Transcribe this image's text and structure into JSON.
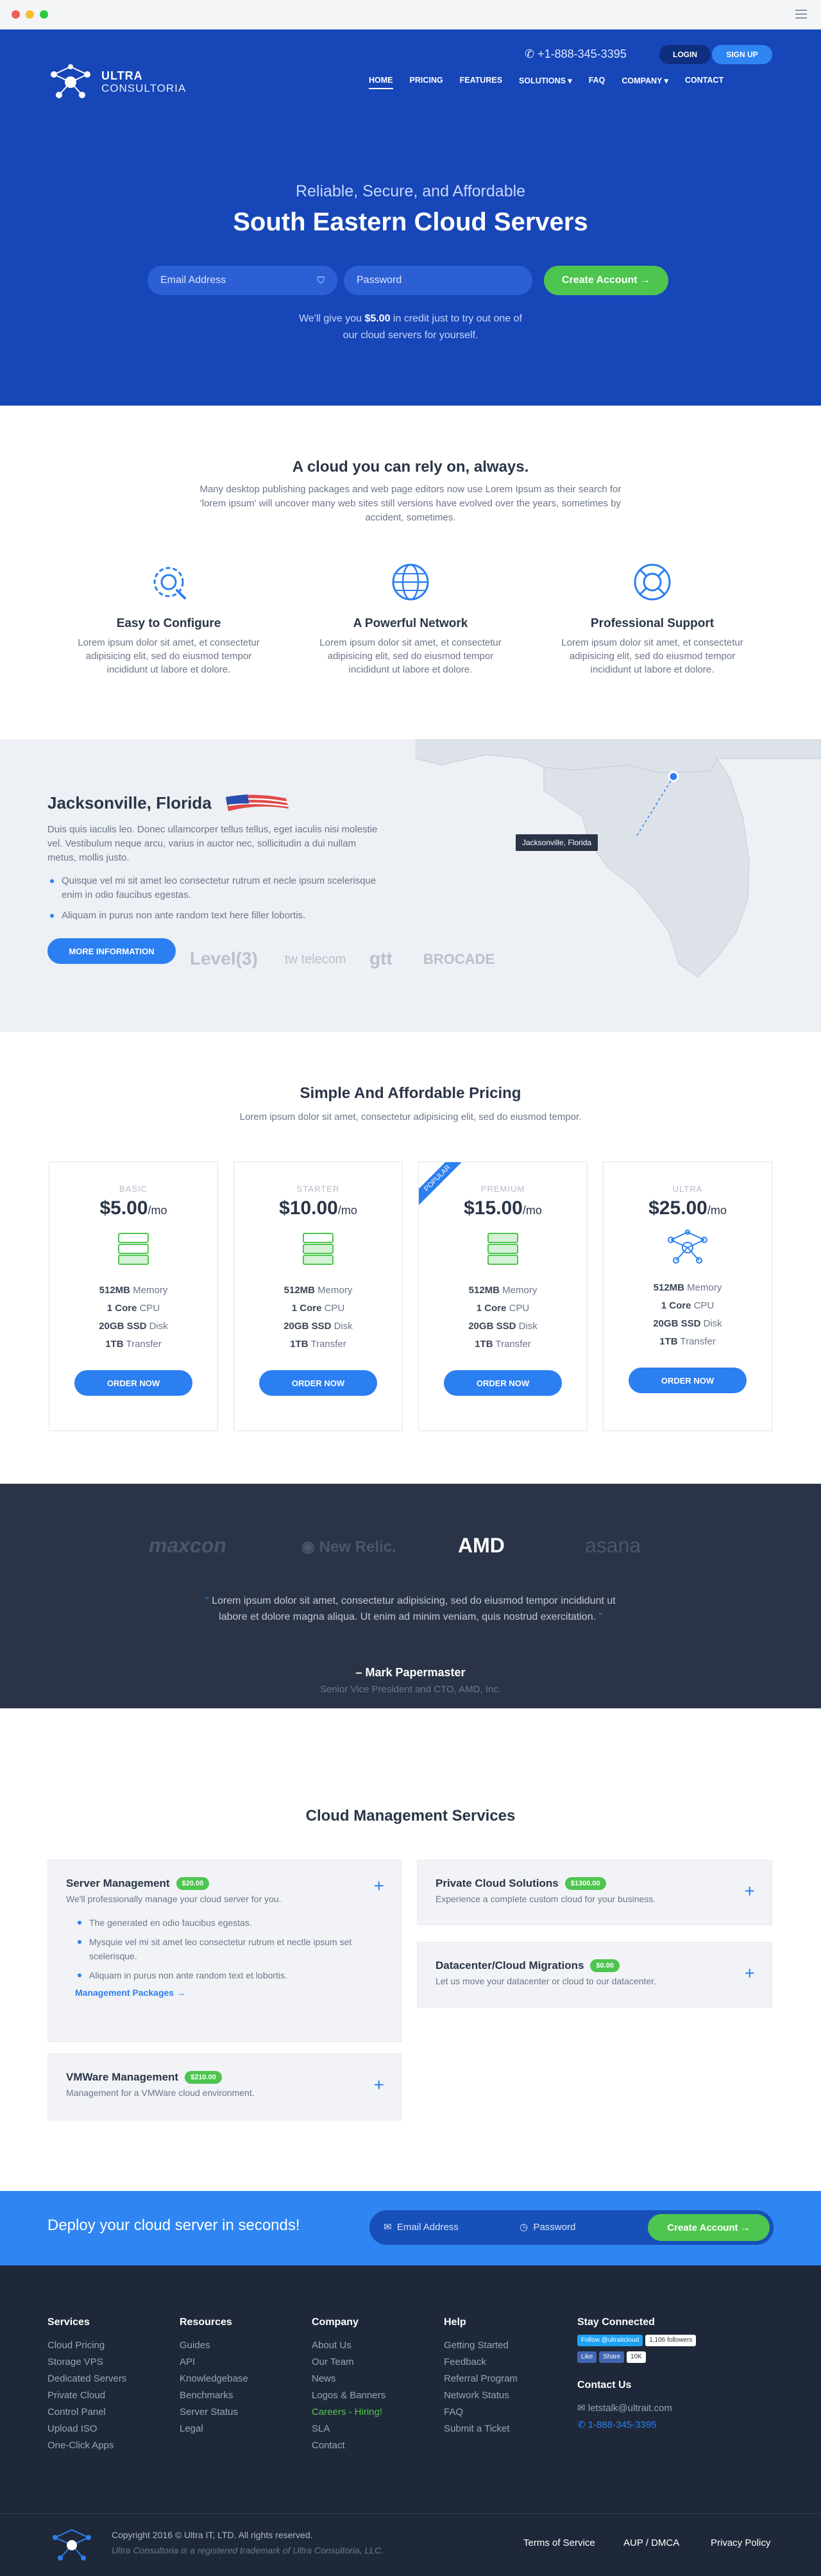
{
  "header": {
    "brand_line1": "ULTRA",
    "brand_line2": "CONSULTORIA",
    "phone": "+1-888-345-3395",
    "login": "LOGIN",
    "signup": "SIGN UP",
    "nav": [
      {
        "label": "HOME"
      },
      {
        "label": "PRICING"
      },
      {
        "label": "FEATURES"
      },
      {
        "label": "SOLUTIONS ▾"
      },
      {
        "label": "FAQ"
      },
      {
        "label": "COMPANY ▾"
      },
      {
        "label": "CONTACT"
      }
    ]
  },
  "hero": {
    "subtitle": "Reliable, Secure, and Affordable",
    "title": "South Eastern Cloud Servers",
    "email_placeholder": "Email Address",
    "password_placeholder": "Password",
    "cta": "Create Account  →",
    "note_before": "We'll give you ",
    "note_amount": "$5.00",
    "note_after": " in credit just to try out one of",
    "note_line2": "our cloud servers for yourself."
  },
  "features": {
    "title": "A cloud you can rely on, always.",
    "intro": "Many desktop publishing packages and web page editors now use Lorem Ipsum as their search for 'lorem ipsum' will uncover many web sites still versions have evolved over the years, sometimes by accident, sometimes.",
    "items": [
      {
        "icon": "gear-icon",
        "title": "Easy to Configure",
        "desc": "Lorem ipsum dolor sit amet, et consectetur adipisicing elit, sed do eiusmod tempor incididunt ut labore et dolore."
      },
      {
        "icon": "globe-icon",
        "title": "A Powerful Network",
        "desc": "Lorem ipsum dolor sit amet, et consectetur adipisicing elit, sed do eiusmod tempor incididunt ut labore et dolore."
      },
      {
        "icon": "lifebuoy-icon",
        "title": "Professional Support",
        "desc": "Lorem ipsum dolor sit amet, et consectetur adipisicing elit, sed do eiusmod tempor incididunt ut labore et dolore."
      }
    ]
  },
  "location": {
    "title": "Jacksonville, Florida",
    "desc": "Duis quis iaculis leo. Donec ullamcorper tellus tellus, eget iaculis nisi molestie vel. Vestibulum neque arcu, varius in auctor nec, sollicitudin a dui nullam metus, mollis justo.",
    "bullets": [
      "Quisque vel mi sit amet leo consectetur rutrum et necle ipsum scelerisque enim in odio faucibus egestas.",
      "Aliquam in purus non ante random text here filler lobortis."
    ],
    "button": "MORE INFORMATION",
    "map_label": "Jacksonville, Florida",
    "partners": [
      "Level(3)",
      "tw telecom",
      "gtt",
      "BROCADE"
    ]
  },
  "pricing": {
    "title": "Simple And Affordable Pricing",
    "subtitle": "Lorem ipsum dolor sit amet, consectetur adipisicing elit, sed do eiusmod tempor.",
    "popular": "Popular",
    "plans": [
      {
        "name": "BASIC",
        "price": "5.00",
        "memory": "512MB",
        "cpu": "1 Core",
        "disk": "20GB SSD",
        "transfer": "1TB",
        "button": "ORDER NOW"
      },
      {
        "name": "STARTER",
        "price": "10.00",
        "memory": "512MB",
        "cpu": "1 Core",
        "disk": "20GB SSD",
        "transfer": "1TB",
        "button": "ORDER NOW"
      },
      {
        "name": "PREMIUM",
        "price": "15.00",
        "memory": "512MB",
        "cpu": "1 Core",
        "disk": "20GB SSD",
        "transfer": "1TB",
        "button": "ORDER NOW"
      },
      {
        "name": "ULTRA",
        "price": "25.00",
        "memory": "512MB",
        "cpu": "1 Core",
        "disk": "20GB SSD",
        "transfer": "1TB",
        "button": "ORDER NOW"
      }
    ],
    "currency": "$",
    "period": "/mo",
    "label_memory": "Memory",
    "label_cpu": "CPU",
    "label_disk": "Disk",
    "label_transfer": "Transfer"
  },
  "testimonial": {
    "logos": [
      "maxcon",
      "New Relic.",
      "AMD",
      "asana"
    ],
    "quote": "Lorem ipsum dolor sit amet, consectetur adipisicing, sed do eiusmod tempor incididunt ut labore et dolore magna aliqua. Ut enim ad minim veniam, quis nostrud exercitation.",
    "author": "– Mark Papermaster",
    "role": "Senior Vice President and CTO, AMD, Inc."
  },
  "services": {
    "title": "Cloud Management Services",
    "items": [
      {
        "name": "Server Management",
        "price": "$20.00",
        "desc": "We'll professionally manage your cloud server for you.",
        "bullets": [
          "The generated en odio faucibus egestas.",
          "Mysquie vel mi sit amet leo consectetur rutrum et nectle ipsum set scelerisque.",
          "Aliquam in purus non ante random text et lobortis."
        ],
        "link": "Management Packages  →"
      },
      {
        "name": "Private Cloud Solutions",
        "price": "$1300.00",
        "desc": "Experience a complete custom cloud for your business."
      },
      {
        "name": "Datacenter/Cloud Migrations",
        "price": "$0.00",
        "desc": "Let us move your datacenter or cloud to our datacenter."
      },
      {
        "name": "VMWare Management",
        "price": "$210.00",
        "desc": "Management for a VMWare cloud environment."
      }
    ]
  },
  "deploy": {
    "title": "Deploy your cloud server in seconds!",
    "email_placeholder": "Email Address",
    "password_placeholder": "Password",
    "cta": "Create Account  →"
  },
  "footer": {
    "columns": [
      {
        "title": "Services",
        "links": [
          "Cloud Pricing",
          "Storage VPS",
          "Dedicated Servers",
          "Private Cloud",
          "Control Panel",
          "Upload ISO",
          "One-Click Apps"
        ]
      },
      {
        "title": "Resources",
        "links": [
          "Guides",
          "API",
          "Knowledgebase",
          "Benchmarks",
          "Server Status",
          "Legal"
        ]
      },
      {
        "title": "Company",
        "links": [
          "About Us",
          "Our Team",
          "News",
          "Logos & Banners",
          "Careers - Hiring!",
          "SLA",
          "Contact"
        ]
      },
      {
        "title": "Help",
        "links": [
          "Getting Started",
          "Feedback",
          "Referral Program",
          "Network Status",
          "FAQ",
          "Submit a Ticket"
        ]
      }
    ],
    "stay_connected": "Stay Connected",
    "twitter": "Follow @ultraitcloud",
    "twitter_count": "1,106 followers",
    "fb_like": "Like",
    "fb_share": "Share",
    "fb_count": "10K",
    "contact_title": "Contact Us",
    "email": "letstalk@ultrait.com",
    "phone": "1-888-345-3395",
    "copyright": "Copyright 2016 © Ultra IT, LTD. All rights reserved.",
    "trademark": "Ultra Consultoria is a registered trademark of Ultra Consultoria, LLC.",
    "legal": [
      "Terms of Service",
      "AUP / DMCA",
      "Privacy Policy"
    ]
  }
}
